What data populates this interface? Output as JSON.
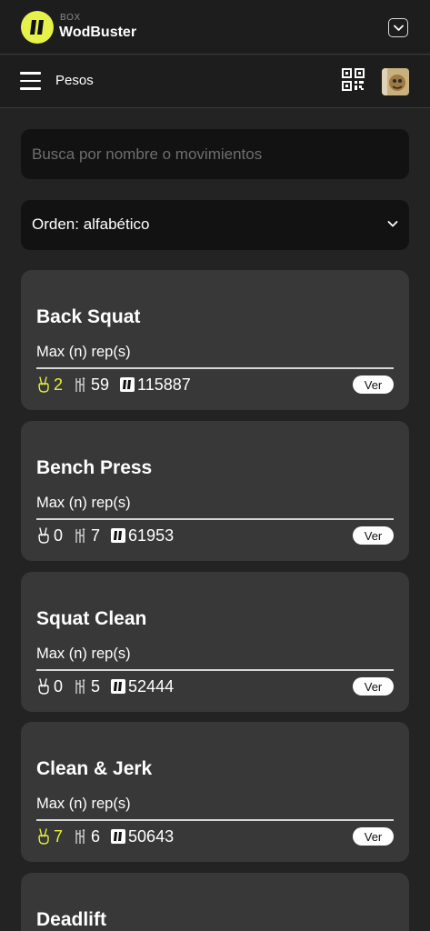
{
  "header": {
    "brand_small": "BOX",
    "brand_name": "WodBuster"
  },
  "nav": {
    "title": "Pesos"
  },
  "search": {
    "placeholder": "Busca por nombre o movimientos",
    "value": ""
  },
  "sort": {
    "label": "Orden: alfabético"
  },
  "colors": {
    "highlight": "#e8ef3a",
    "card_bg": "#383838",
    "page_bg": "#232323",
    "input_bg": "#121212"
  },
  "exercises": [
    {
      "name": "Back Squat",
      "subtitle": "Max (n) rep(s)",
      "peace": "2",
      "users": "59",
      "total": "115887",
      "highlight": true,
      "button": "Ver"
    },
    {
      "name": "Bench Press",
      "subtitle": "Max (n) rep(s)",
      "peace": "0",
      "users": "7",
      "total": "61953",
      "highlight": false,
      "button": "Ver"
    },
    {
      "name": "Squat Clean",
      "subtitle": "Max (n) rep(s)",
      "peace": "0",
      "users": "5",
      "total": "52444",
      "highlight": false,
      "button": "Ver"
    },
    {
      "name": "Clean & Jerk",
      "subtitle": "Max (n) rep(s)",
      "peace": "7",
      "users": "6",
      "total": "50643",
      "highlight": true,
      "button": "Ver"
    },
    {
      "name": "Deadlift"
    }
  ]
}
